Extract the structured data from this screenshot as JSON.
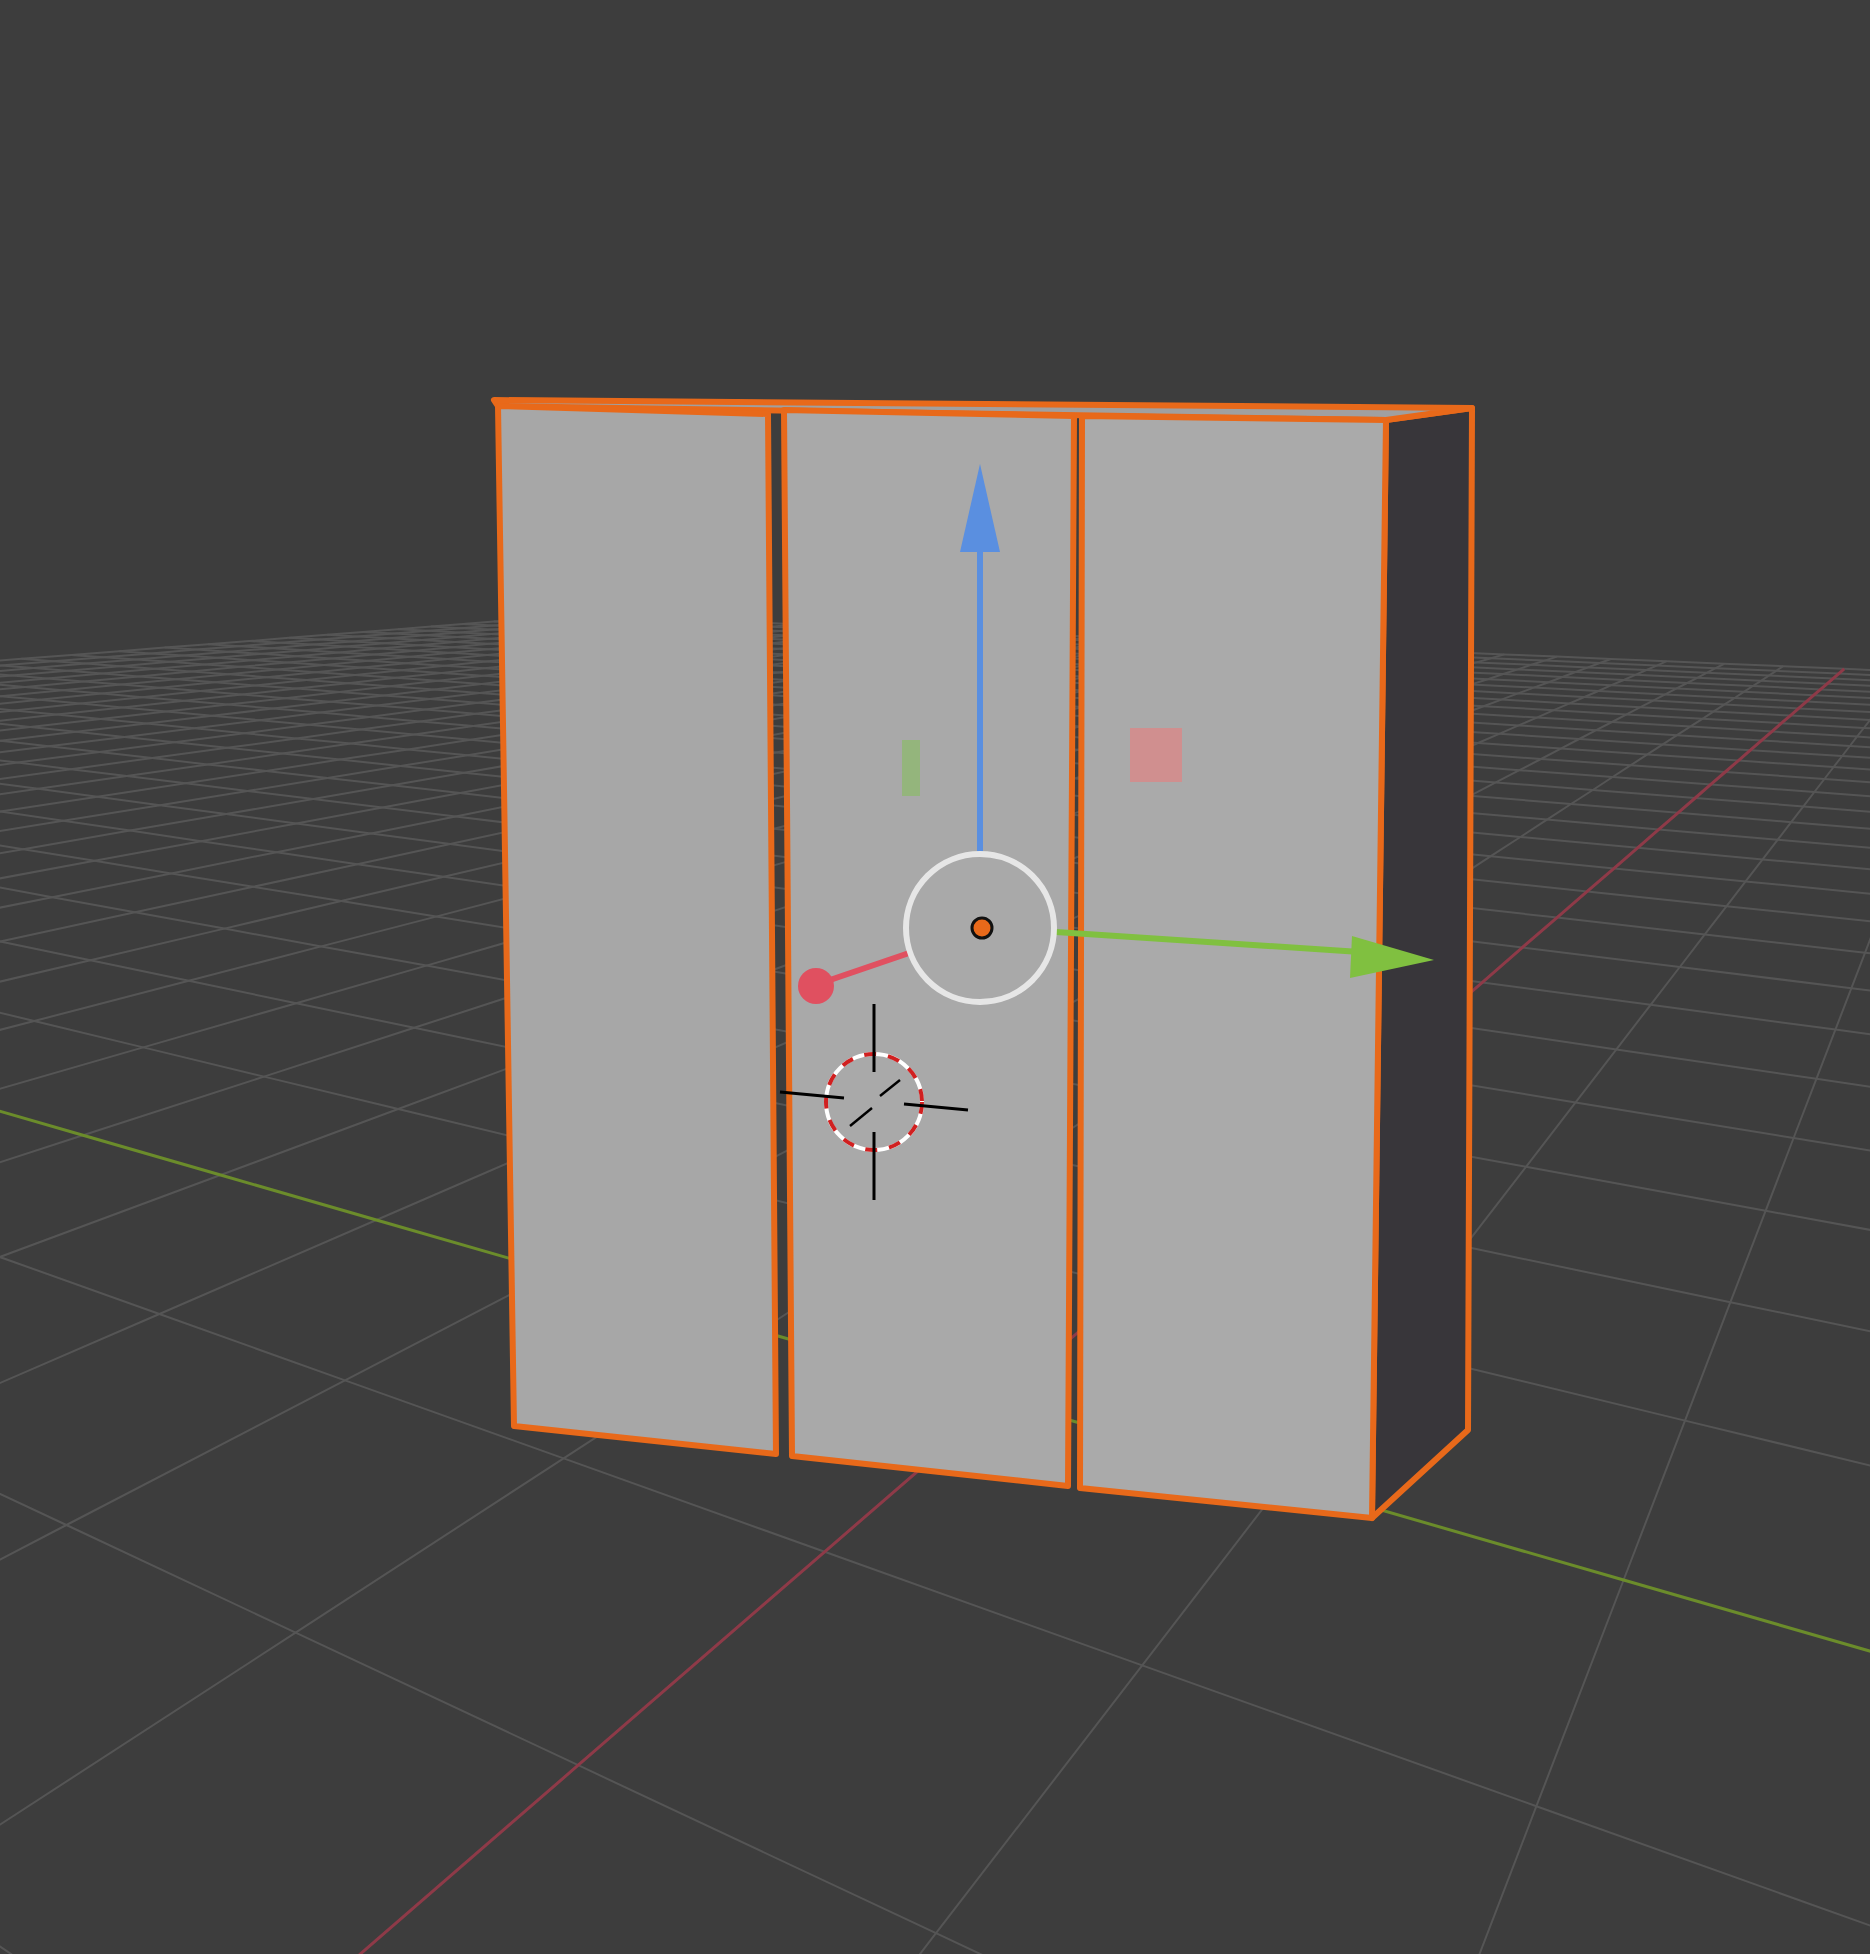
{
  "viewport": {
    "object": {
      "selected": true
    },
    "gizmo": {
      "kind": "translate"
    }
  }
}
